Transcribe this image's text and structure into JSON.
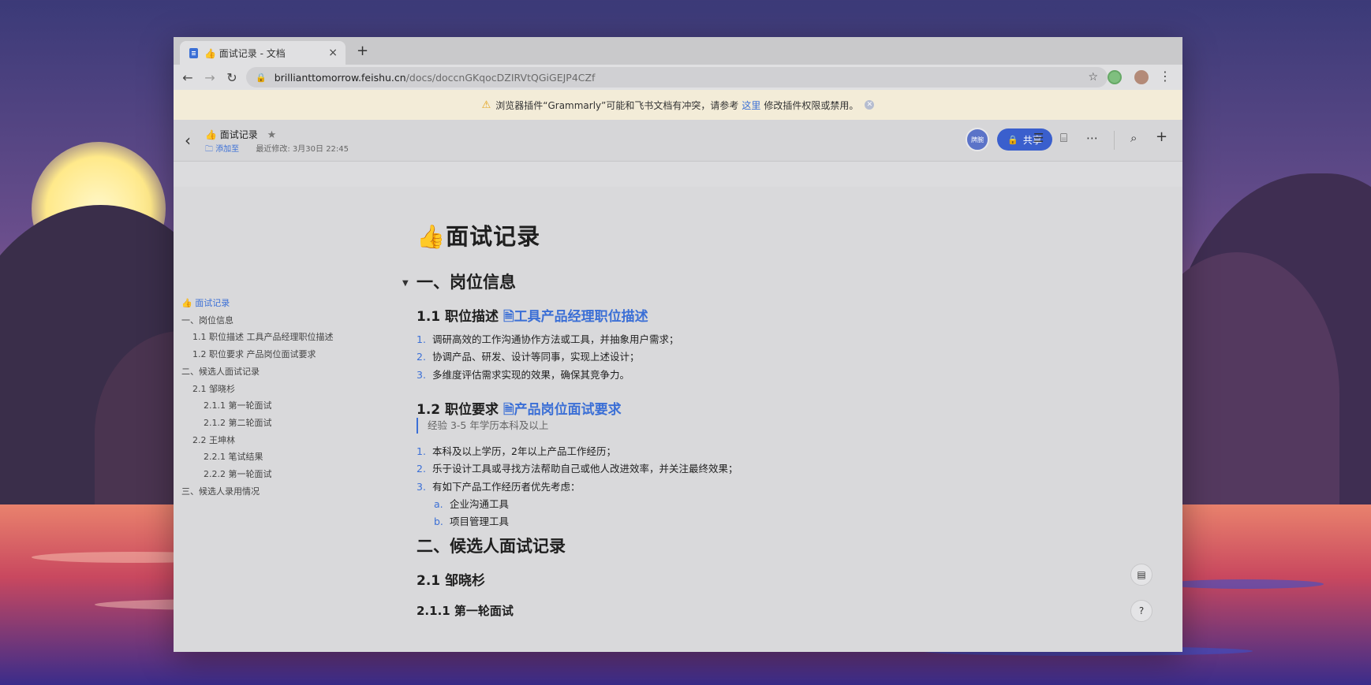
{
  "browser": {
    "tab_title": "👍 面试记录 - 文档",
    "tab_close": "×",
    "new_tab": "+",
    "url_host": "brillianttomorrow.feishu.cn",
    "url_path": "/docs/doccnGKqocDZIRVtQGiGEJP4CZf"
  },
  "warning": {
    "text_before": "浏览器插件“Grammarly”可能和飞书文档有冲突，请参考",
    "link": "这里",
    "text_after": "修改插件权限或禁用。"
  },
  "doc_header": {
    "title": "👍 面试记录",
    "add_to": "添加至",
    "last_modified": "最近修改: 3月30日 22:45",
    "avatar_text": "牌腕",
    "share_label": "共享"
  },
  "toc": [
    {
      "label": "👍 面试记录",
      "level": 0
    },
    {
      "label": "一、岗位信息",
      "level": 1
    },
    {
      "label": "1.1 职位描述 工具产品经理职位描述",
      "level": 2
    },
    {
      "label": "1.2 职位要求 产品岗位面试要求",
      "level": 2
    },
    {
      "label": "二、候选人面试记录",
      "level": 1
    },
    {
      "label": "2.1 邹晓杉",
      "level": 2
    },
    {
      "label": "2.1.1 第一轮面试",
      "level": 3
    },
    {
      "label": "2.1.2 第二轮面试",
      "level": 3
    },
    {
      "label": "2.2 王坤林",
      "level": 2
    },
    {
      "label": "2.2.1 笔试结果",
      "level": 3
    },
    {
      "label": "2.2.2 第一轮面试",
      "level": 3
    },
    {
      "label": "三、候选人录用情况",
      "level": 1
    }
  ],
  "content": {
    "title": "👍面试记录",
    "section1": "一、岗位信息",
    "s11_prefix": "1.1 职位描述",
    "s11_link": "工具产品经理职位描述",
    "s11_items": [
      "调研高效的工作沟通协作方法或工具，并抽象用户需求；",
      "协调产品、研发、设计等同事，实现上述设计；",
      "多维度评估需求实现的效果，确保其竞争力。"
    ],
    "s12_prefix": "1.2 职位要求",
    "s12_link": "产品岗位面试要求",
    "quote": "经验 3-5 年学历本科及以上",
    "s12_items": [
      "本科及以上学历，2年以上产品工作经历；",
      "乐于设计工具或寻找方法帮助自己或他人改进效率，并关注最终效果；",
      "有如下产品工作经历者优先考虑："
    ],
    "s12_sub": [
      {
        "marker": "a.",
        "text": "企业沟通工具"
      },
      {
        "marker": "b.",
        "text": "项目管理工具"
      }
    ],
    "section2": "二、候选人面试记录",
    "s21": "2.1 邹晓杉",
    "s211": "2.1.1 第一轮面试"
  }
}
